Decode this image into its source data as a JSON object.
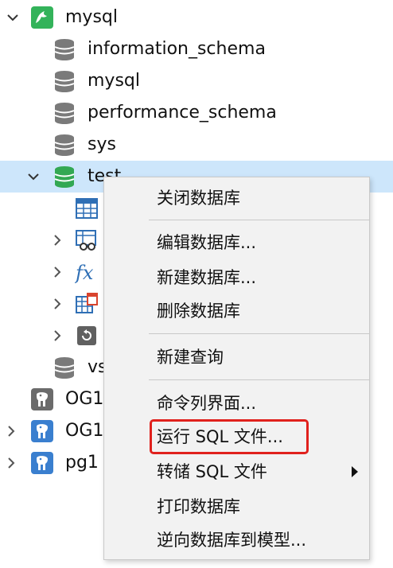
{
  "tree": {
    "connection": {
      "label": "mysql",
      "icon": "mysql-dolphin-icon"
    },
    "databases": [
      {
        "label": "information_schema",
        "icon": "database-icon"
      },
      {
        "label": "mysql",
        "icon": "database-icon"
      },
      {
        "label": "performance_schema",
        "icon": "database-icon"
      },
      {
        "label": "sys",
        "icon": "database-icon"
      },
      {
        "label": "test",
        "icon": "database-open-icon",
        "selected": true
      }
    ],
    "test_children": [
      {
        "icon": "table-icon"
      },
      {
        "icon": "view-icon"
      },
      {
        "icon": "function-icon"
      },
      {
        "icon": "event-icon"
      },
      {
        "icon": "backup-icon"
      }
    ],
    "after_db": {
      "label": "vs",
      "icon": "database-icon"
    },
    "other_connections": [
      {
        "label": "OG1",
        "icon": "postgresql-elephant-icon"
      },
      {
        "label": "OG1",
        "icon": "postgresql-elephant-icon"
      },
      {
        "label": "pg1",
        "icon": "postgresql-elephant-icon"
      }
    ]
  },
  "context_menu": {
    "items": [
      {
        "label": "关闭数据库"
      },
      {
        "label": "编辑数据库..."
      },
      {
        "label": "新建数据库..."
      },
      {
        "label": "删除数据库"
      },
      {
        "label": "新建查询"
      },
      {
        "label": "命令列界面..."
      },
      {
        "label": "运行 SQL 文件...",
        "highlighted": true
      },
      {
        "label": "转储 SQL 文件",
        "has_submenu": true
      },
      {
        "label": "打印数据库"
      },
      {
        "label": "逆向数据库到模型..."
      }
    ]
  },
  "colors": {
    "selection": "#cde6fb",
    "highlight_border": "#e0211d",
    "mysql_icon": "#33b35a",
    "postgres_icon": "#3a7fcf",
    "db_icon": "#7a7a7a",
    "db_open_icon": "#33a853"
  }
}
